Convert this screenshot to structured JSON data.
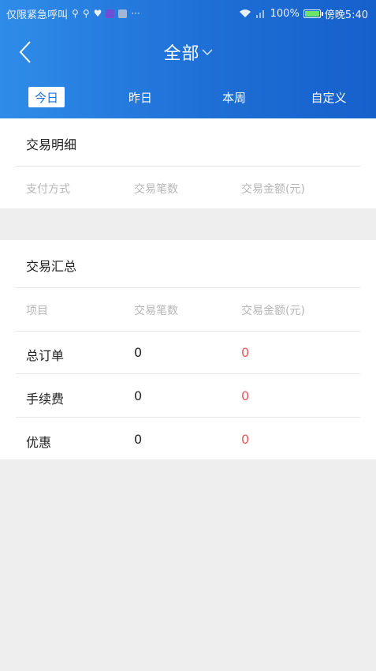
{
  "status_bar": {
    "carrier_text": "仅限紧急呼叫",
    "battery": "100%",
    "time": "傍晚5:40"
  },
  "nav": {
    "title": "全部"
  },
  "tabs": [
    {
      "label": "今日",
      "active": true
    },
    {
      "label": "昨日",
      "active": false
    },
    {
      "label": "本周",
      "active": false
    },
    {
      "label": "自定义",
      "active": false
    }
  ],
  "detail": {
    "title": "交易明细",
    "columns": [
      "支付方式",
      "交易笔数",
      "交易金额(元)"
    ]
  },
  "summary": {
    "title": "交易汇总",
    "columns": [
      "项目",
      "交易笔数",
      "交易金额(元)"
    ],
    "rows": [
      {
        "label": "总订单",
        "count": "0",
        "amount": "0"
      },
      {
        "label": "手续费",
        "count": "0",
        "amount": "0"
      },
      {
        "label": "优惠",
        "count": "0",
        "amount": "0"
      }
    ]
  },
  "colors": {
    "header_start": "#2f8ce8",
    "header_end": "#1660cc",
    "amount": "#e55b5b"
  }
}
